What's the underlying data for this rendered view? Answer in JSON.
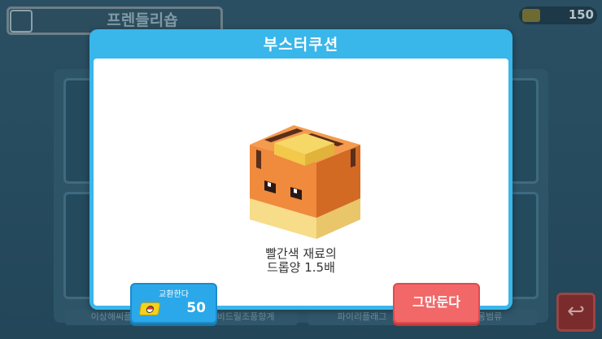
{
  "background": {
    "shop_title": "프렌들리숍",
    "currency_amount": "150",
    "bottom_labels": [
      "이상해씨플래그",
      "깨비드릴조풍향계",
      "파이리플래그",
      "메타몽범류"
    ]
  },
  "dialog": {
    "title": "부스터쿠션",
    "item_description_line1": "빨간색 재료의",
    "item_description_line2": "드롭양 1.5배",
    "exchange_button": {
      "label": "교환한다",
      "cost": "50"
    },
    "quit_button_label": "그만둔다"
  },
  "icons": {
    "shop": "shop-icon",
    "ticket": "pokemon-ticket-icon",
    "back": "back-arrow-icon"
  },
  "colors": {
    "dialog_header": "#39b6ea",
    "exchange_button": "#2aa8ea",
    "quit_button": "#f26767",
    "ticket": "#f2d21b",
    "item_orange": "#f08a3c",
    "item_cream": "#f7dc8a"
  }
}
